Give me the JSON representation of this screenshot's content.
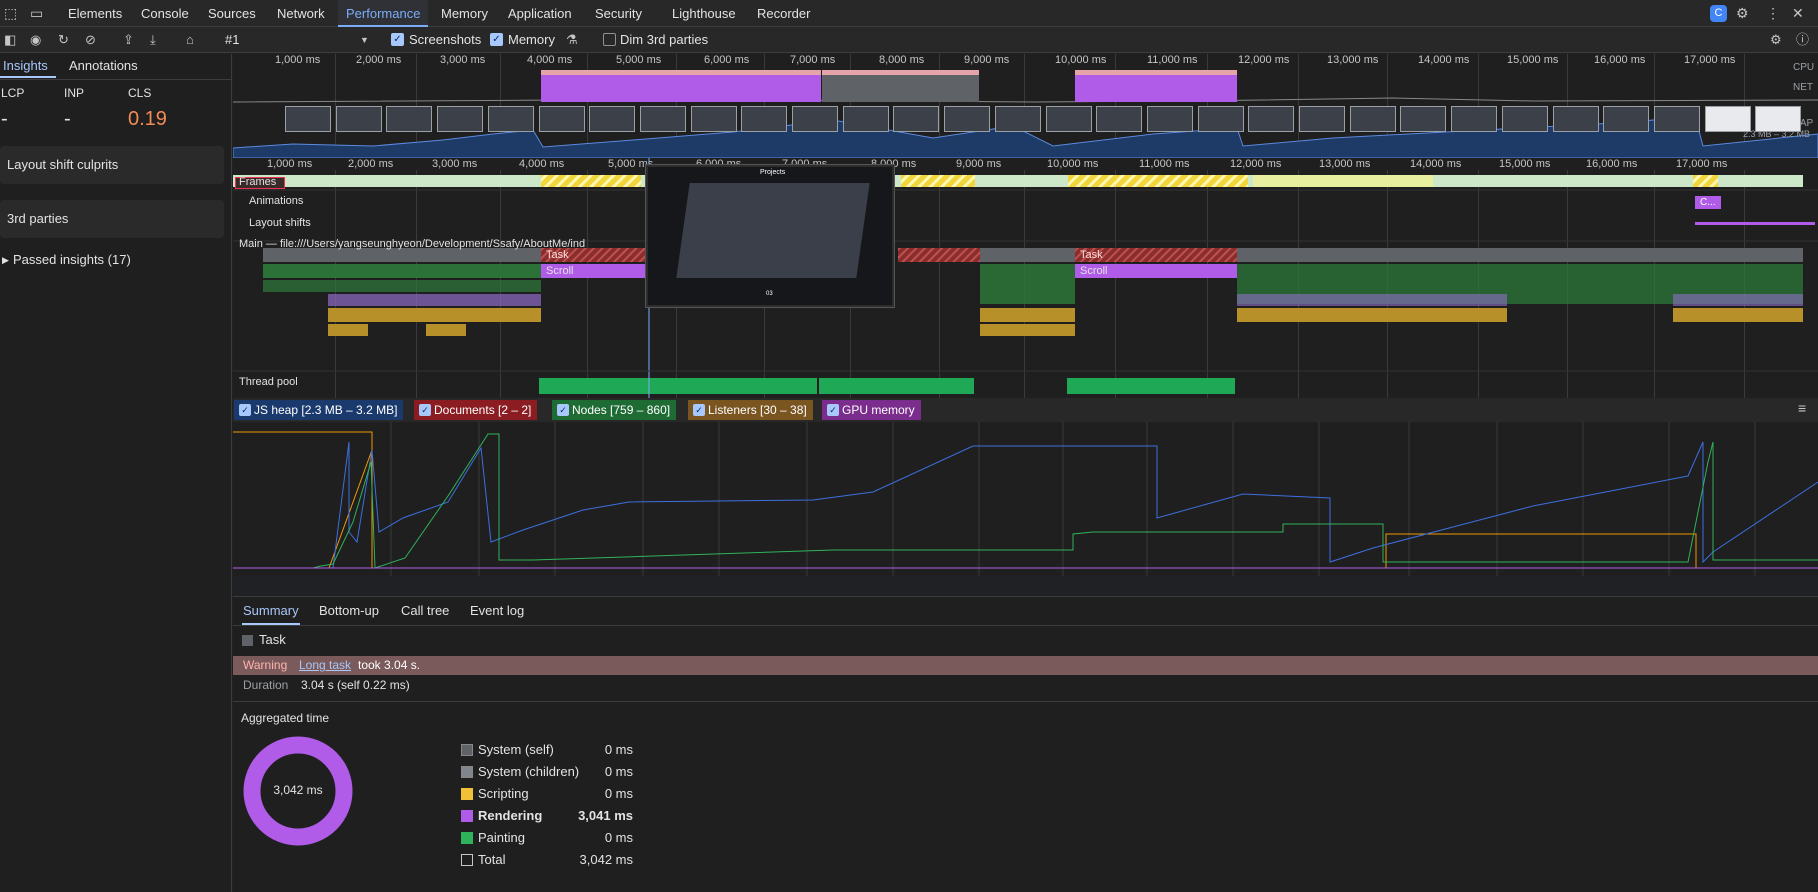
{
  "top_tabs": [
    "Elements",
    "Console",
    "Sources",
    "Network",
    "Performance",
    "Memory",
    "Application",
    "Security",
    "Lighthouse",
    "Recorder"
  ],
  "toolbar": {
    "recording": "#1",
    "screenshots_label": "Screenshots",
    "memory_label": "Memory",
    "dim_label": "Dim 3rd parties"
  },
  "sidebar": {
    "tabs": [
      "Insights",
      "Annotations"
    ],
    "metrics": [
      {
        "label": "LCP",
        "value": "-"
      },
      {
        "label": "INP",
        "value": "-"
      },
      {
        "label": "CLS",
        "value": "0.19",
        "color": "#f28b54"
      }
    ],
    "cards": [
      "Layout shift culprits",
      "3rd parties"
    ],
    "passed": "Passed insights (17)"
  },
  "ruler": [
    "1,000 ms",
    "2,000 ms",
    "3,000 ms",
    "4,000 ms",
    "5,000 ms",
    "6,000 ms",
    "7,000 ms",
    "8,000 ms",
    "9,000 ms",
    "10,000 ms",
    "11,000 ms",
    "12,000 ms",
    "13,000 ms",
    "14,000 ms",
    "15,000 ms",
    "16,000 ms",
    "17,000 ms"
  ],
  "overview_labels": {
    "cpu": "CPU",
    "net": "NET",
    "heap": "HEAP",
    "heap_range": "2.3 MB – 3.2 MB"
  },
  "tracks": {
    "frames": "Frames",
    "animations": "Animations",
    "animation_block": "C...",
    "layout_shifts": "Layout shifts",
    "main": "Main — file:///Users/yangseunghyeon/Development/Ssafy/AboutMe/ind",
    "task": "Task",
    "scroll": "Scroll",
    "thread_pool": "Thread pool"
  },
  "popup": {
    "title": "Projects",
    "caption": "03"
  },
  "counters": [
    {
      "label": "JS heap [2.3 MB – 3.2 MB]",
      "color": "#1a3a6e"
    },
    {
      "label": "Documents [2 – 2]",
      "color": "#8a1c22"
    },
    {
      "label": "Nodes [759 – 860]",
      "color": "#1e6b34"
    },
    {
      "label": "Listeners [30 – 38]",
      "color": "#7a5520"
    },
    {
      "label": "GPU memory",
      "color": "#7b2d8e"
    }
  ],
  "bottom_tabs": [
    "Summary",
    "Bottom-up",
    "Call tree",
    "Event log"
  ],
  "summary": {
    "title": "Task",
    "warning_label": "Warning",
    "warning_link": "Long task",
    "warning_text": "took 3.04 s.",
    "duration_label": "Duration",
    "duration_value": "3.04 s (self 0.22 ms)",
    "aggregated_title": "Aggregated time",
    "donut_center": "3,042 ms",
    "rows": [
      {
        "value": "0 ms",
        "name": "System (self)",
        "color": "#5f6368"
      },
      {
        "value": "0 ms",
        "name": "System (children)",
        "color": "#80868b"
      },
      {
        "value": "0 ms",
        "name": "Scripting",
        "color": "#f2c037"
      },
      {
        "value": "3,041 ms",
        "name": "Rendering",
        "color": "#b05ce8",
        "bold": true
      },
      {
        "value": "0 ms",
        "name": "Painting",
        "color": "#2fb35a"
      },
      {
        "value": "3,042 ms",
        "name": "Total",
        "color": "transparent"
      }
    ]
  }
}
